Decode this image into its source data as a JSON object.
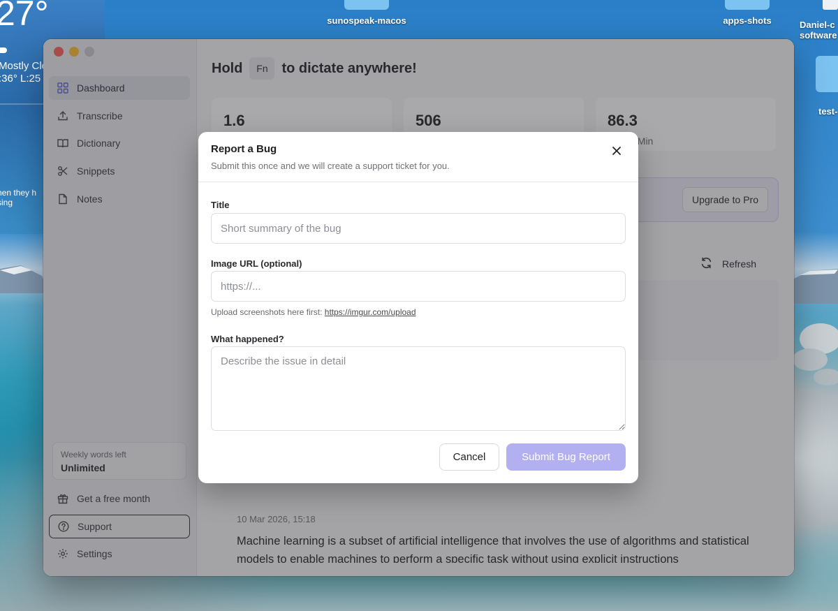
{
  "desktop": {
    "weather": {
      "temperature": "27°",
      "condition": "Mostly Clo",
      "high_low": ":36° L:25",
      "tip_line1": "hen they h",
      "tip_line2": "sing"
    },
    "icons": [
      {
        "label": "sunospeak-macos"
      },
      {
        "label": "apps-shots"
      },
      {
        "label_line1": "Daniel-c",
        "label_line2": "software"
      },
      {
        "label": "test-"
      }
    ]
  },
  "sidebar": {
    "items": [
      {
        "label": "Dashboard",
        "icon": "grid-icon",
        "active": true
      },
      {
        "label": "Transcribe",
        "icon": "upload-icon"
      },
      {
        "label": "Dictionary",
        "icon": "book-icon"
      },
      {
        "label": "Snippets",
        "icon": "scissors-icon"
      },
      {
        "label": "Notes",
        "icon": "document-icon"
      }
    ],
    "weekly_words": {
      "label": "Weekly words left",
      "value": "Unlimited"
    },
    "bottom_items": [
      {
        "label": "Get a free month",
        "icon": "gift-icon"
      },
      {
        "label": "Support",
        "icon": "help-circle-icon"
      },
      {
        "label": "Settings",
        "icon": "gear-icon"
      }
    ]
  },
  "main": {
    "hold_prefix": "Hold",
    "hold_key": "Fn",
    "hold_suffix": "to dictate anywhere!",
    "stats": [
      {
        "value": "1.6",
        "label": ""
      },
      {
        "value": "506",
        "label": ""
      },
      {
        "value": "86.3",
        "label": "/ Min"
      }
    ],
    "upgrade_label": "Upgrade to Pro",
    "refresh_label": "Refresh",
    "entry": {
      "date": "10 Mar 2026, 15:18",
      "text": "Machine learning is a subset of artificial intelligence that involves the use of algorithms and statistical models to enable machines to perform a specific task without using explicit instructions"
    }
  },
  "modal": {
    "title": "Report a Bug",
    "subtitle": "Submit this once and we will create a support ticket for you.",
    "title_field": {
      "label": "Title",
      "placeholder": "Short summary of the bug",
      "value": ""
    },
    "image_field": {
      "label": "Image URL (optional)",
      "placeholder": "https://...",
      "value": ""
    },
    "hint_prefix": "Upload screenshots here first:",
    "hint_link": "https://imgur.com/upload",
    "details_field": {
      "label": "What happened?",
      "placeholder": "Describe the issue in detail",
      "value": ""
    },
    "cancel_label": "Cancel",
    "submit_label": "Submit Bug Report"
  }
}
